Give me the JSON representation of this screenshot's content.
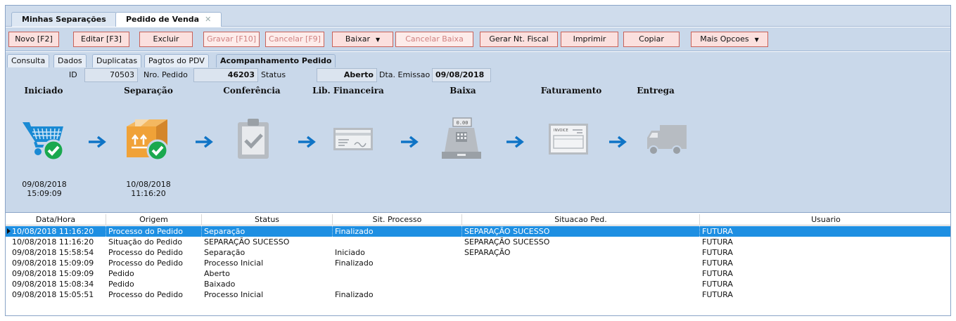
{
  "top_tabs": [
    {
      "label": "Minhas Separações"
    },
    {
      "label": "Pedido de Venda",
      "close": "✕"
    }
  ],
  "toolbar": {
    "novo": "Novo [F2]",
    "editar": "Editar [F3]",
    "excluir": "Excluir",
    "gravar": "Gravar [F10]",
    "cancelar": "Cancelar [F9]",
    "baixar": "Baixar",
    "cancelar_baixa": "Cancelar Baixa",
    "gerar_nf": "Gerar Nt. Fiscal",
    "imprimir": "Imprimir",
    "copiar": "Copiar",
    "mais_opcoes": "Mais Opcoes",
    "caret": "▼"
  },
  "sub_tabs": [
    {
      "label": "Consulta"
    },
    {
      "label": "Dados"
    },
    {
      "label": "Duplicatas"
    },
    {
      "label": "Pagtos do PDV"
    },
    {
      "label": "Acompanhamento Pedido"
    }
  ],
  "fields": {
    "id_label": "ID",
    "id_value": "70503",
    "pedido_label": "Nro. Pedido",
    "pedido_value": "46203",
    "status_label": "Status",
    "status_value": "Aberto",
    "emissao_label": "Dta. Emissao",
    "emissao_value": "09/08/2018"
  },
  "steps": [
    {
      "label": "Iniciado",
      "icon": "cart-check-icon",
      "date": "09/08/2018",
      "time": "15:09:09"
    },
    {
      "label": "Separação",
      "icon": "box-check-icon",
      "date": "10/08/2018",
      "time": "11:16:20"
    },
    {
      "label": "Conferência",
      "icon": "clipboard-check-icon"
    },
    {
      "label": "Lib. Financeira",
      "icon": "cheque-icon"
    },
    {
      "label": "Baixa",
      "icon": "cash-register-icon",
      "register_display": "0.00"
    },
    {
      "label": "Faturamento",
      "icon": "invoice-icon",
      "invoice_text": "INVOICE"
    },
    {
      "label": "Entrega",
      "icon": "truck-icon"
    }
  ],
  "colors": {
    "done_blue": "#1a8ad4",
    "check_green": "#1aa84e",
    "pending_gray": "#b7bcc2",
    "arrow_blue": "#0f74c6",
    "selected_row": "#1e8fe2"
  },
  "grid": {
    "headers": [
      "Data/Hora",
      "Origem",
      "Status",
      "Sit. Processo",
      "Situacao Ped.",
      "Usuario"
    ],
    "rows": [
      [
        "10/08/2018 11:16:20",
        "Processo do Pedido",
        "Separação",
        "Finalizado",
        "SEPARAÇÃO SUCESSO",
        "FUTURA"
      ],
      [
        "10/08/2018 11:16:20",
        "Situação do Pedido",
        "SEPARAÇÃO SUCESSO",
        "",
        "SEPARAÇÃO SUCESSO",
        "FUTURA"
      ],
      [
        "09/08/2018 15:58:54",
        "Processo do Pedido",
        "Separação",
        "Iniciado",
        "SEPARAÇÃO",
        "FUTURA"
      ],
      [
        "09/08/2018 15:09:09",
        "Processo do Pedido",
        "Processo Inicial",
        "Finalizado",
        "",
        "FUTURA"
      ],
      [
        "09/08/2018 15:09:09",
        "Pedido",
        "Aberto",
        "",
        "",
        "FUTURA"
      ],
      [
        "09/08/2018 15:08:34",
        "Pedido",
        "Baixado",
        "",
        "",
        "FUTURA"
      ],
      [
        "09/08/2018 15:05:51",
        "Processo do Pedido",
        "Processo Inicial",
        "Finalizado",
        "",
        "FUTURA"
      ]
    ]
  }
}
